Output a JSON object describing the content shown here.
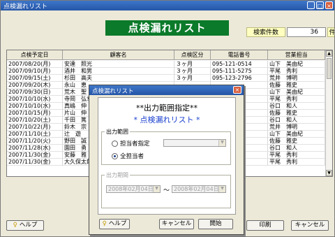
{
  "window": {
    "title": "点検漏れリスト"
  },
  "banner": "点検漏れリスト",
  "count": {
    "label": "検索件数",
    "value": "36",
    "unit": "件"
  },
  "table": {
    "headers": [
      "点検予定日",
      "顧客名",
      "点検区分",
      "電話番号",
      "営業担当"
    ],
    "rows": [
      [
        "2007/08/20(月)",
        "安達　照光",
        "３ヶ月",
        "095-121-0514",
        "山下　美由紀"
      ],
      [
        "2007/09/10(月)",
        "酒井　和男",
        "３ヶ月",
        "095-111-5275",
        "平尾　秀利"
      ],
      [
        "2007/09/15(土)",
        "杉田　高夫",
        "３ヶ月",
        "095-123-2796",
        "荒井　博明"
      ],
      [
        "2007/09/20(木)",
        "永山　恵",
        "",
        "",
        "佐藤　雅史"
      ],
      [
        "2007/09/30(日)",
        "荒木　聖",
        "",
        "",
        "山下　美由紀"
      ],
      [
        "2007/10/10(水)",
        "寺岡　弘幸",
        "",
        "",
        "平尾　秀利"
      ],
      [
        "2007/10/10(水)",
        "真嶋　伸",
        "",
        "",
        "谷口　和人"
      ],
      [
        "2007/10/15(月)",
        "片山　伸",
        "",
        "",
        "佐藤　雅史"
      ],
      [
        "2007/10/20(土)",
        "千田　篤",
        "",
        "",
        "谷口　和人"
      ],
      [
        "2007/10/22(月)",
        "鈴木　宗",
        "",
        "",
        "荒井　博明"
      ],
      [
        "2007/11/10(土)",
        "辻　遊",
        "",
        "",
        "山下　美由紀"
      ],
      [
        "2007/11/20(火)",
        "野田　誠",
        "",
        "",
        "佐藤　雅史"
      ],
      [
        "2007/11/28(水)",
        "園田　勇",
        "",
        "",
        "谷口　和人"
      ],
      [
        "2007/11/30(金)",
        "安藤　雅",
        "",
        "",
        "平尾　秀利"
      ],
      [
        "2007/11/30(金)",
        "大久保太郎",
        "",
        "",
        "平尾　秀利"
      ]
    ]
  },
  "buttons": {
    "help": "ヘルプ",
    "print": "印刷",
    "cancel": "キャンセル"
  },
  "dialog": {
    "title": "点検漏れリスト",
    "header1": "**出力範囲指定**",
    "header2": "* 点検漏れリスト *",
    "range_legend": "出力範囲",
    "radio_staff": "担当者指定",
    "radio_all": "全担当者",
    "period_legend": "出力期間",
    "date_from": "2008年02月04日",
    "date_to": "2008年02月04日",
    "tilde": "〜",
    "help": "ヘルプ",
    "cancel": "キャンセル",
    "start": "開始"
  }
}
